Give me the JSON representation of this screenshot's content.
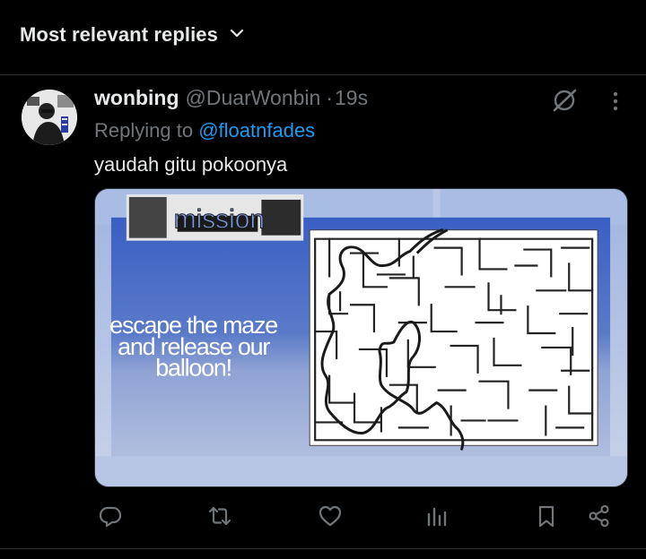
{
  "sort": {
    "label": "Most relevant replies"
  },
  "tweet": {
    "display_name": "wonbing",
    "handle": "@DuarWonbin",
    "separator": "·",
    "time": "19s",
    "replying_prefix": "Replying to",
    "replying_to": "@floatnfades",
    "text": "yaudah gitu pokoonya",
    "media": {
      "banner_text": "mission",
      "caption_lines": [
        "escape the maze",
        "and release our",
        "balloon!"
      ]
    }
  },
  "icons": {
    "sort": "chevron-down-icon",
    "grok": "grok-icon",
    "more": "more-icon",
    "reply": "reply-icon",
    "retweet": "retweet-icon",
    "like": "like-icon",
    "views": "views-icon",
    "bookmark": "bookmark-icon",
    "share": "share-icon"
  },
  "colors": {
    "background": "#000000",
    "text_primary": "#e7e9ea",
    "text_secondary": "#71767b",
    "accent": "#1d9bf0",
    "divider": "#2f3336"
  }
}
